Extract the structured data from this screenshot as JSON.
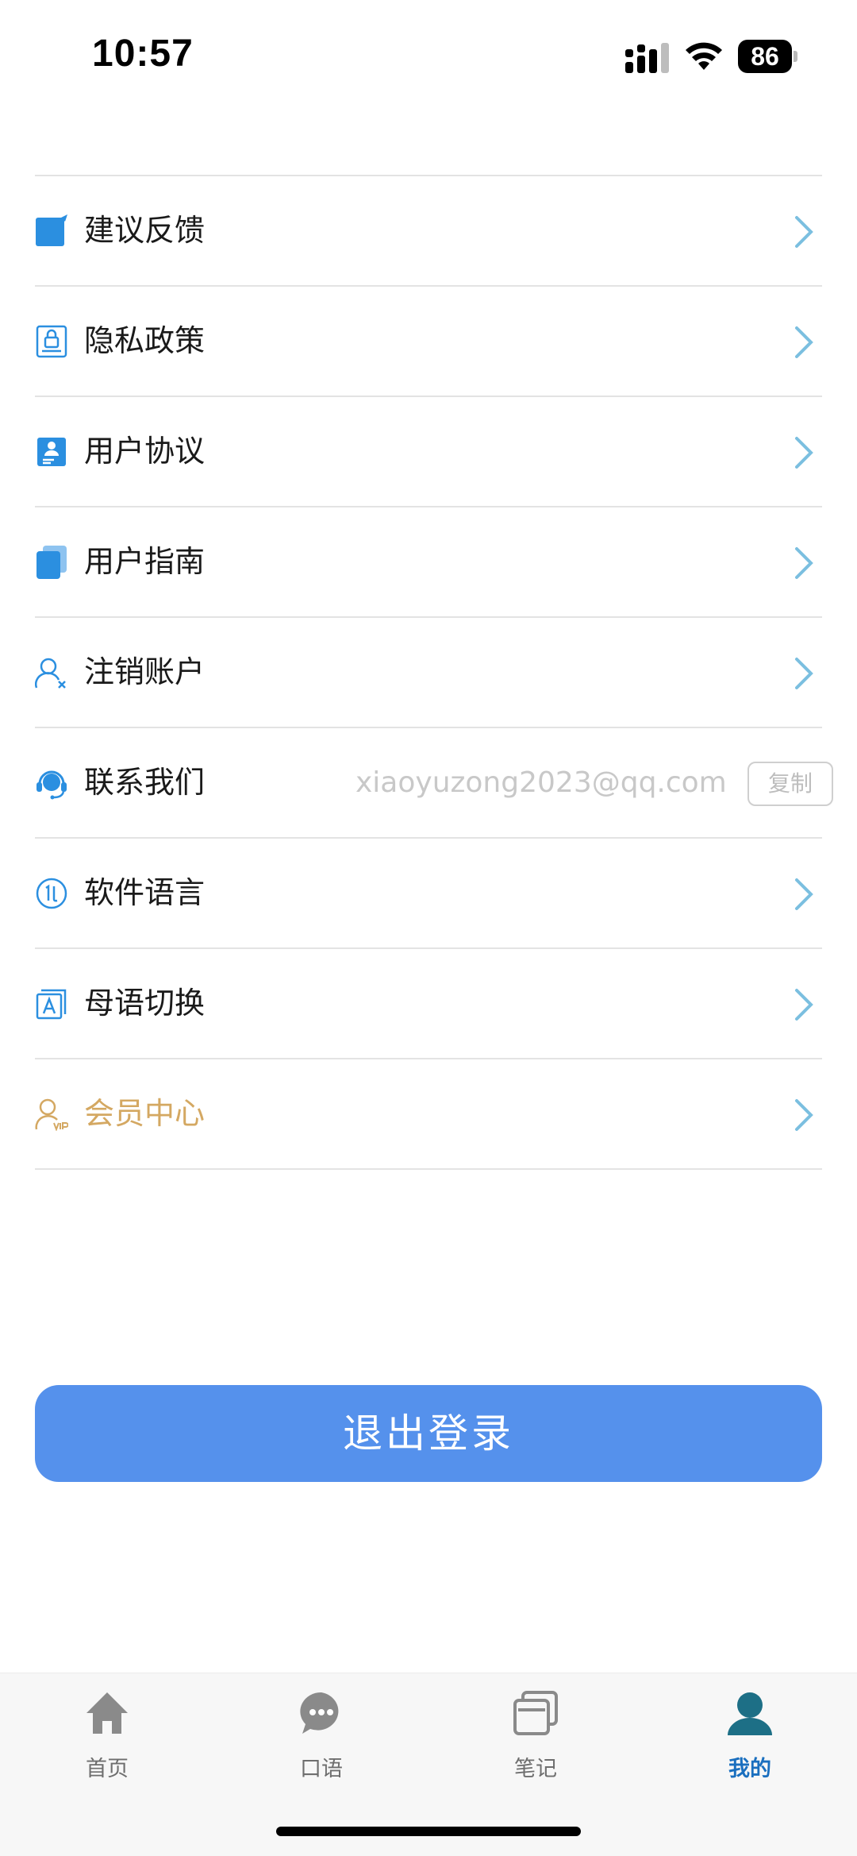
{
  "status_bar": {
    "time": "10:57",
    "battery": "86"
  },
  "menu": [
    {
      "id": "feedback",
      "label": "建议反馈",
      "icon": "feedback-icon"
    },
    {
      "id": "privacy",
      "label": "隐私政策",
      "icon": "lock-document-icon"
    },
    {
      "id": "agreement",
      "label": "用户协议",
      "icon": "user-agreement-icon"
    },
    {
      "id": "guide",
      "label": "用户指南",
      "icon": "guide-book-icon"
    },
    {
      "id": "cancel-account",
      "label": "注销账户",
      "icon": "user-remove-icon"
    },
    {
      "id": "contact",
      "label": "联系我们",
      "icon": "headset-icon",
      "email": "xiaoyuzong2023@qq.com",
      "copy_label": "复制"
    },
    {
      "id": "language",
      "label": "软件语言",
      "icon": "language-icon"
    },
    {
      "id": "native-language",
      "label": "母语切换",
      "icon": "translate-icon"
    },
    {
      "id": "vip",
      "label": "会员中心",
      "icon": "vip-user-icon"
    }
  ],
  "logout_label": "退出登录",
  "tabs": [
    {
      "label": "首页",
      "icon": "home-icon",
      "active": false
    },
    {
      "label": "口语",
      "icon": "chat-bubble-icon",
      "active": false
    },
    {
      "label": "笔记",
      "icon": "notes-icon",
      "active": false
    },
    {
      "label": "我的",
      "icon": "profile-icon",
      "active": true
    }
  ],
  "colors": {
    "accent": "#5591ec",
    "icon_blue": "#2b8fe0",
    "chevron": "#7bbfe0",
    "vip_gold": "#d4a862",
    "active_tab": "#1a6fbf"
  }
}
